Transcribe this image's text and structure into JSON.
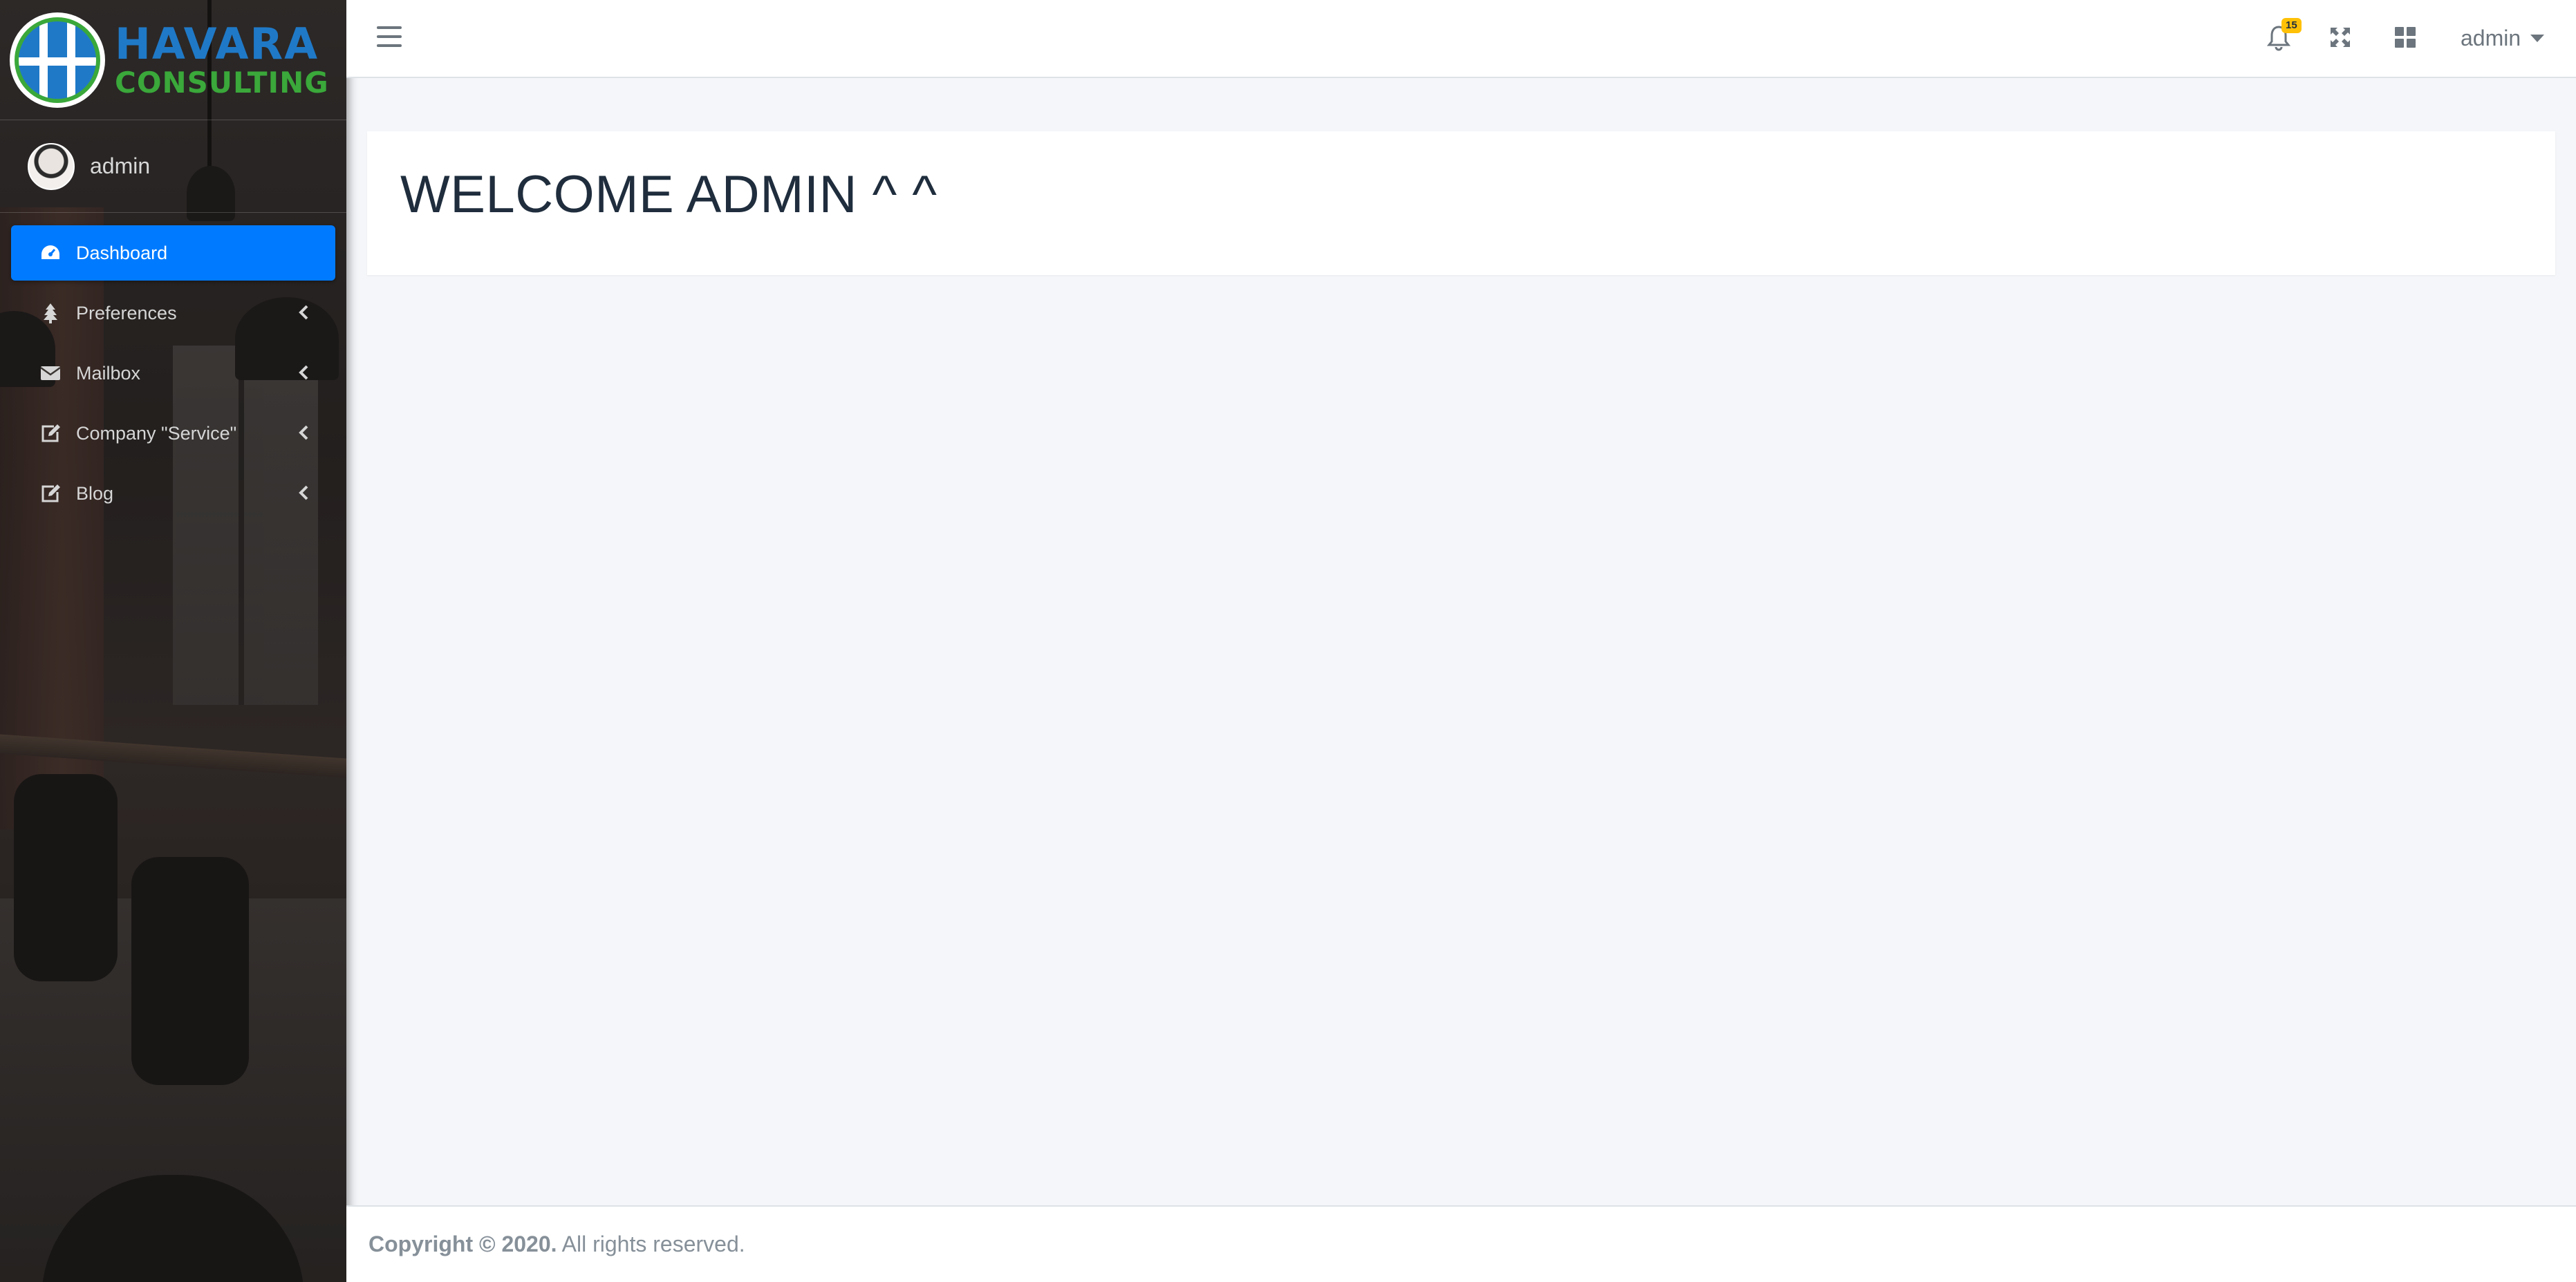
{
  "brand": {
    "line1": "HAVARA",
    "line2": "CONSULTING"
  },
  "user_panel": {
    "name": "admin"
  },
  "sidebar": {
    "items": [
      {
        "label": "Dashboard",
        "icon": "tachometer-icon",
        "active": true
      },
      {
        "label": "Preferences",
        "icon": "tree-icon",
        "has_submenu": true
      },
      {
        "label": "Mailbox",
        "icon": "envelope-icon",
        "has_submenu": true
      },
      {
        "label": "Company \"Service\"",
        "icon": "edit-icon",
        "has_submenu": true
      },
      {
        "label": "Blog",
        "icon": "edit-icon",
        "has_submenu": true
      }
    ]
  },
  "topbar": {
    "notifications_count": "15",
    "user_menu_label": "admin"
  },
  "main": {
    "welcome_text": "WELCOME ADMIN ^ ^"
  },
  "footer": {
    "copyright": "Copyright © 2020.",
    "rights": " All rights reserved."
  },
  "colors": {
    "accent": "#007bff",
    "badge": "#ffc107",
    "logo_blue": "#1f79c7",
    "logo_green": "#3aa83a"
  }
}
